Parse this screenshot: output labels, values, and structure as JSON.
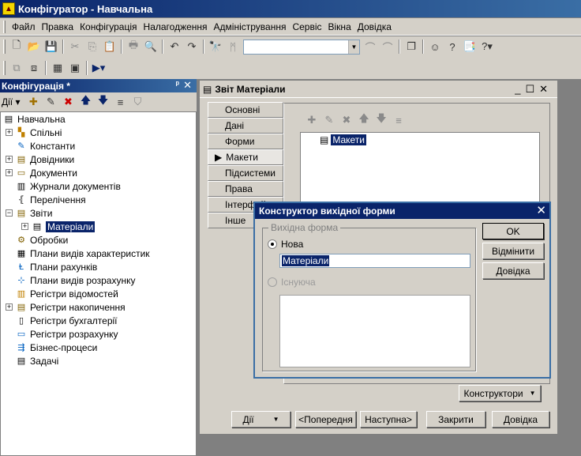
{
  "app": {
    "title": "Конфігуратор - Навчальна"
  },
  "menu": [
    "Файл",
    "Правка",
    "Конфігурація",
    "Налагодження",
    "Адміністрування",
    "Сервіс",
    "Вікна",
    "Довідка"
  ],
  "config_panel": {
    "title": "Конфігурація *",
    "actions_label": "Дії",
    "tree": [
      {
        "label": "Навчальна",
        "level": 0,
        "expander": "",
        "icon": "config-root-icon"
      },
      {
        "label": "Спільні",
        "level": 1,
        "expander": "+",
        "icon": "common-icon"
      },
      {
        "label": "Константи",
        "level": 1,
        "expander": "",
        "icon": "constants-icon"
      },
      {
        "label": "Довідники",
        "level": 1,
        "expander": "+",
        "icon": "catalogs-icon"
      },
      {
        "label": "Документи",
        "level": 1,
        "expander": "+",
        "icon": "documents-icon"
      },
      {
        "label": "Журнали документів",
        "level": 1,
        "expander": "",
        "icon": "journals-icon"
      },
      {
        "label": "Перелічення",
        "level": 1,
        "expander": "",
        "icon": "enums-icon"
      },
      {
        "label": "Звіти",
        "level": 1,
        "expander": "-",
        "icon": "reports-icon"
      },
      {
        "label": "Матеріали",
        "level": 2,
        "expander": "+",
        "icon": "report-item-icon",
        "selected": true
      },
      {
        "label": "Обробки",
        "level": 1,
        "expander": "",
        "icon": "processing-icon"
      },
      {
        "label": "Плани видів характеристик",
        "level": 1,
        "expander": "",
        "icon": "char-plans-icon"
      },
      {
        "label": "Плани рахунків",
        "level": 1,
        "expander": "",
        "icon": "accounts-plans-icon"
      },
      {
        "label": "Плани видів розрахунку",
        "level": 1,
        "expander": "",
        "icon": "calc-plans-icon"
      },
      {
        "label": "Регістри відомостей",
        "level": 1,
        "expander": "",
        "icon": "info-registers-icon"
      },
      {
        "label": "Регістри накопичення",
        "level": 1,
        "expander": "+",
        "icon": "accum-registers-icon"
      },
      {
        "label": "Регістри бухгалтерії",
        "level": 1,
        "expander": "",
        "icon": "acc-registers-icon"
      },
      {
        "label": "Регістри розрахунку",
        "level": 1,
        "expander": "",
        "icon": "calc-registers-icon"
      },
      {
        "label": "Бізнес-процеси",
        "level": 1,
        "expander": "",
        "icon": "business-process-icon"
      },
      {
        "label": "Задачі",
        "level": 1,
        "expander": "",
        "icon": "tasks-icon"
      }
    ]
  },
  "report_window": {
    "title": "Звіт Матеріали",
    "tabs": [
      "Основні",
      "Дані",
      "Форми",
      "Макети",
      "Підсистеми",
      "Права",
      "Інтерфейс",
      "Інше"
    ],
    "active_tab": "Макети",
    "list_item": "Макети",
    "constructors_label": "Конструктори",
    "buttons": {
      "actions": "Дії",
      "prev": "<Попередня",
      "next": "Наступна>",
      "close": "Закрити",
      "help": "Довідка"
    }
  },
  "dialog": {
    "title": "Конструктор вихідної форми",
    "group_label": "Вихідна форма",
    "option_new": "Нова",
    "option_existing": "Існуюча",
    "name_value": "Матеріали",
    "ok": "OK",
    "cancel": "Відмінити",
    "help": "Довідка"
  }
}
